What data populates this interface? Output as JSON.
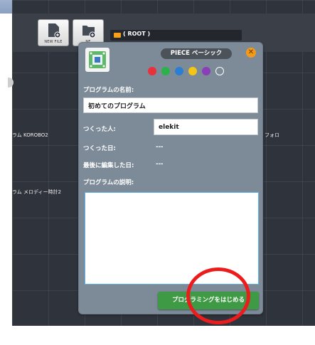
{
  "toolbar": {
    "new_file_label": "NEW FILE",
    "new_folder_label": "NE",
    "path_text": "( ROOT )"
  },
  "files": {
    "label_1": "ラム KOROBO2",
    "label_2": "ラム メロディー時計2",
    "label_3": "フォロ"
  },
  "dialog": {
    "board_type": "PIECE ベーシック",
    "close_symbol": "✕",
    "colors": [
      "#e8313b",
      "#2cb24a",
      "#2b7fd0",
      "#f3c515",
      "#8a3fb8",
      "#ffffff"
    ],
    "name_label": "プログラムの名前:",
    "name_value": "初めてのプログラム",
    "author_label": "つくった人:",
    "author_value": "elekit",
    "created_label": "つくった日:",
    "created_value": "---",
    "modified_label": "最後に編集した日:",
    "modified_value": "---",
    "description_label": "プログラムの説明:",
    "description_value": "",
    "start_button": "プログラミングをはじめる"
  }
}
